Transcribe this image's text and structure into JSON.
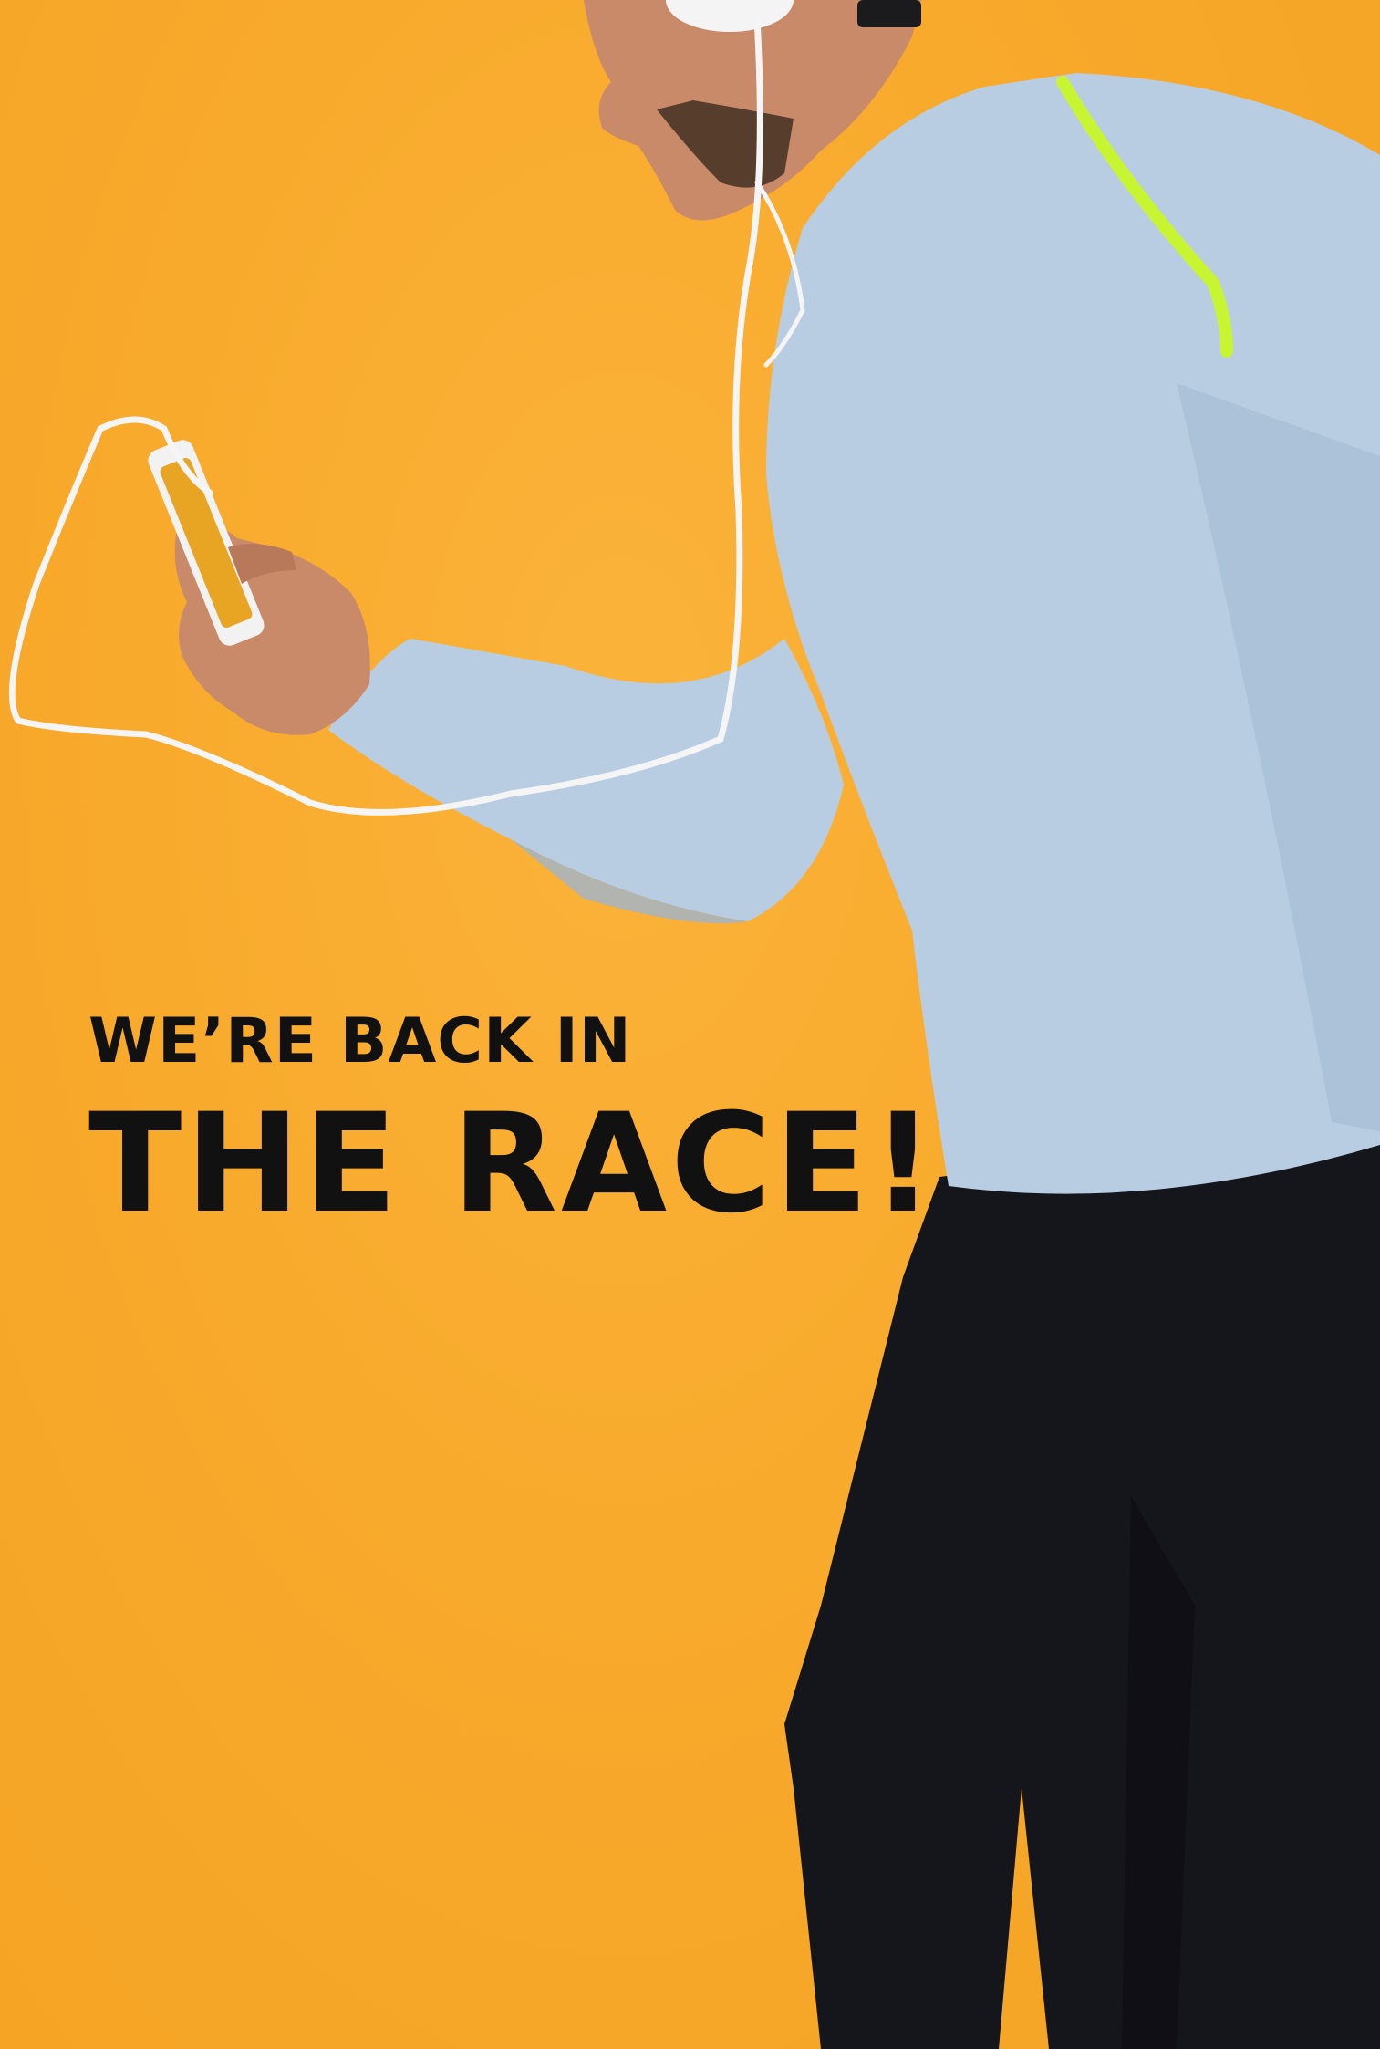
{
  "headline": {
    "line1": "WE’RE BACK IN",
    "line2": "THE RACE!"
  },
  "colors": {
    "background": "#f7a928",
    "headline": "#111111",
    "shirt": "#b9cde2",
    "shirt_accent": "#c8f531",
    "pants": "#14161c",
    "skin": "#c98a6a",
    "cable": "#f5f5f5"
  }
}
